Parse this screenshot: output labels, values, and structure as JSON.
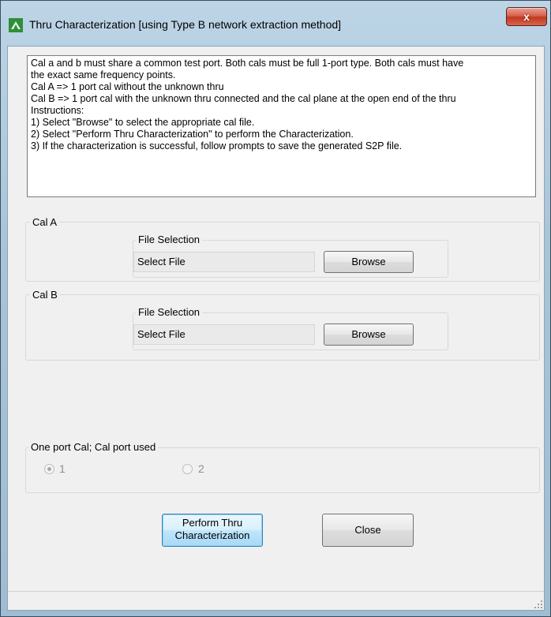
{
  "window": {
    "title": "Thru Characterization [using Type B network extraction method]",
    "close_glyph": "x"
  },
  "instructions": [
    "Cal a and b must share a common test port.  Both cals must be full 1-port type.  Both cals must have",
    "the exact same frequency points.",
    "Cal A => 1 port cal without the unknown thru",
    "Cal B => 1 port cal with the unknown thru connected and the cal plane at the open end of the thru",
    "Instructions:",
    "1) Select \"Browse\" to select the appropriate cal file.",
    "2) Select \"Perform Thru Characterization\" to perform the Characterization.",
    "3) If the characterization is successful, follow prompts to save the generated S2P file."
  ],
  "cal_a": {
    "label": "Cal A",
    "file_selection_label": "File Selection",
    "file_value": "Select File",
    "browse_label": "Browse"
  },
  "cal_b": {
    "label": "Cal B",
    "file_selection_label": "File Selection",
    "file_value": "Select File",
    "browse_label": "Browse"
  },
  "port": {
    "label": "One port Cal; Cal port used",
    "options": [
      "1",
      "2"
    ],
    "selected": "1"
  },
  "actions": {
    "perform_line1": "Perform Thru",
    "perform_line2": "Characterization",
    "close_label": "Close"
  },
  "colors": {
    "titlebar": "#a9c4d9",
    "close_button": "#c0391f",
    "client": "#f0f0f0"
  }
}
